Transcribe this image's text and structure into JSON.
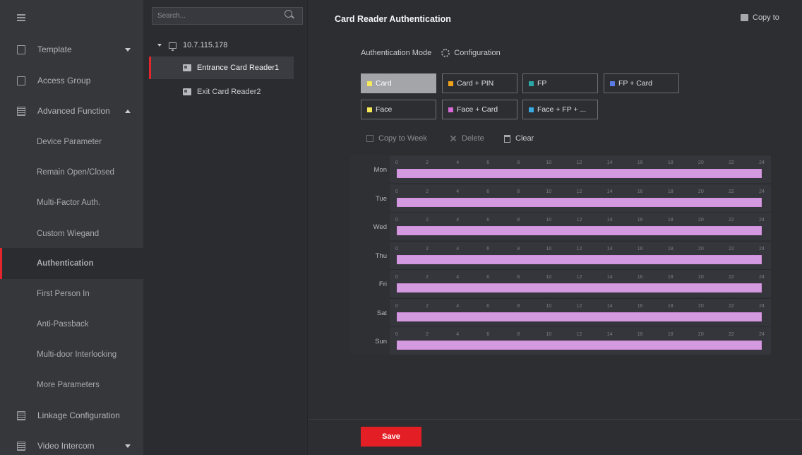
{
  "sidebar": {
    "items": [
      {
        "label": "Template",
        "icon": "template-icon",
        "caret": "down"
      },
      {
        "label": "Access Group",
        "icon": "lock-icon"
      },
      {
        "label": "Advanced Function",
        "icon": "advanced-function-icon",
        "caret": "up"
      },
      {
        "label": "Device Parameter"
      },
      {
        "label": "Remain Open/Closed"
      },
      {
        "label": "Multi-Factor Auth."
      },
      {
        "label": "Custom Wiegand"
      },
      {
        "label": "Authentication",
        "active": true
      },
      {
        "label": "First Person In"
      },
      {
        "label": "Anti-Passback"
      },
      {
        "label": "Multi-door Interlocking"
      },
      {
        "label": "More Parameters"
      },
      {
        "label": "Linkage Configuration",
        "icon": "linkage-icon"
      },
      {
        "label": "Video Intercom",
        "icon": "video-intercom-icon",
        "caret": "down"
      }
    ]
  },
  "tree": {
    "search_placeholder": "Search...",
    "root": "10.7.115.178",
    "nodes": [
      {
        "label": "Entrance Card Reader1",
        "selected": true
      },
      {
        "label": "Exit Card Reader2"
      }
    ]
  },
  "panel": {
    "title": "Card Reader Authentication",
    "copy_to": "Copy to",
    "auth_mode_label": "Authentication Mode",
    "configuration": "Configuration",
    "modes": [
      {
        "label": "Card",
        "color": "#f5e95a",
        "active": true
      },
      {
        "label": "Card + PIN",
        "color": "#f0a21c"
      },
      {
        "label": "FP",
        "color": "#2aa8a8"
      },
      {
        "label": "FP + Card",
        "color": "#5a7be8"
      },
      {
        "label": "Face",
        "color": "#f5e95a"
      },
      {
        "label": "Face + Card",
        "color": "#d86ad8"
      },
      {
        "label": "Face + FP + ...",
        "color": "#3aa9e0"
      }
    ],
    "toolbar": {
      "copy_to_week": "Copy to Week",
      "delete": "Delete",
      "clear": "Clear"
    },
    "schedule": {
      "days": [
        "Mon",
        "Tue",
        "Wed",
        "Thu",
        "Fri",
        "Sat",
        "Sun"
      ],
      "hour_ticks": [
        "0",
        "2",
        "4",
        "6",
        "8",
        "10",
        "12",
        "14",
        "16",
        "18",
        "20",
        "22",
        "24"
      ],
      "bar_color": "#d39adf",
      "bar_mode": "Face + Card",
      "bar_start_hour": 0,
      "bar_end_hour": 24
    },
    "save_label": "Save"
  },
  "colors": {
    "accent": "#e31e24",
    "sidebar_bg": "#36373b",
    "panel_bg": "#2d2e32"
  }
}
